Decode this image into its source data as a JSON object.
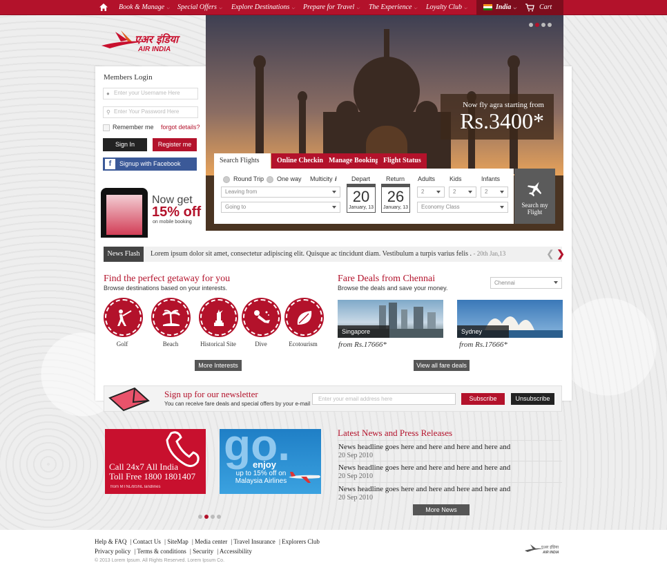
{
  "nav": {
    "items": [
      "Book & Manage",
      "Special Offers",
      "Explore Destinations",
      "Prepare for Travel",
      "The Experience",
      "Loyalty Club"
    ],
    "country": "India",
    "cart": "Cart"
  },
  "brand": {
    "logo_text": "AIR INDIA",
    "accent": "#b3122b"
  },
  "hero": {
    "offer_line1": "Now fly agra starting from",
    "offer_price": "Rs.3400*",
    "slides": 4,
    "active_slide": 2
  },
  "login": {
    "title": "Members Login",
    "username_placeholder": "Enter your Username Here",
    "password_placeholder": "Enter Your Password Here",
    "remember": "Remember me",
    "forgot": "forgot details?",
    "signin": "Sign In",
    "register": "Register me",
    "facebook": "Signup with Facebook Account"
  },
  "mobile_promo": {
    "line1": "Now get",
    "line2": "15% off",
    "line3": "on mobile booking"
  },
  "search": {
    "tabs": [
      "Search Flights",
      "Online Checkin",
      "Manage Booking",
      "Flight Status"
    ],
    "trip_types": [
      "Round Trip",
      "One way",
      "Multicity"
    ],
    "leaving_from": "Leaving from",
    "going_to": "Going to",
    "depart_label": "Depart",
    "return_label": "Return",
    "depart_day": "20",
    "depart_month": "January, 13",
    "return_day": "26",
    "return_month": "January, 13",
    "adults_label": "Adults",
    "kids_label": "Kids",
    "infants_label": "Infants",
    "adults": "2",
    "kids": "2",
    "infants": "2",
    "class": "Economy Class",
    "button_line1": "Search my",
    "button_line2": "Flight"
  },
  "newsflash": {
    "label": "News Flash",
    "text": "Lorem ipsum dolor sit amet, consectetur adipiscing elit. Quisque ac tincidunt diam. Vestibulum a turpis varius felis .",
    "date": "- 20th Jan,13"
  },
  "getaway": {
    "title": "Find the perfect getaway for you",
    "subtitle": "Browse destinations based on your interests.",
    "interests": [
      "Golf",
      "Beach",
      "Historical Site",
      "Dive",
      "Ecotourism"
    ],
    "more": "More Interests"
  },
  "fares": {
    "title": "Fare Deals from Chennai",
    "subtitle": "Browse the deals and save your money.",
    "city_select": "Chennai",
    "deals": [
      {
        "city": "Singapore",
        "price": "from Rs.17666*"
      },
      {
        "city": "Sydney",
        "price": "from Rs.17666*"
      }
    ],
    "view_all": "View all fare deals"
  },
  "newsletter": {
    "title": "Sign up for our newsletter",
    "subtitle": "You can receive fare deals and special offers by your e-mail",
    "placeholder": "Enter your email address here",
    "subscribe": "Subscribe",
    "unsubscribe": "Unsubscribe"
  },
  "banners": {
    "call_line1": "Call 24x7 All India",
    "call_line2": "Toll Free 1800 1801407",
    "call_note": "from MTNL/BSNL landlines",
    "go_big": "go.",
    "go_enjoy": "enjoy",
    "go_line1": "up to 15% off on",
    "go_line2": "Malaysia Airlines"
  },
  "latest_news": {
    "title": "Latest News and Press Releases",
    "items": [
      {
        "headline": "News headline goes here and here and here and here and",
        "date": "20 Sep 2010"
      },
      {
        "headline": "News headline goes here and here and here and here and",
        "date": "20 Sep 2010"
      },
      {
        "headline": "News headline goes here and here and here and here and",
        "date": "20 Sep 2010"
      }
    ],
    "more": "More News"
  },
  "footer": {
    "row1": [
      "Help & FAQ",
      "Contact Us",
      "SiteMap",
      "Media center",
      "Travel Insurance",
      "Explorers Club"
    ],
    "row2": [
      "Privacy policy",
      "Terms & conditions",
      "Security",
      "Accessibility"
    ],
    "copyright": "© 2013 Lorem Ipsum. All Rights Reserved. Lorem Ipsum Co."
  }
}
